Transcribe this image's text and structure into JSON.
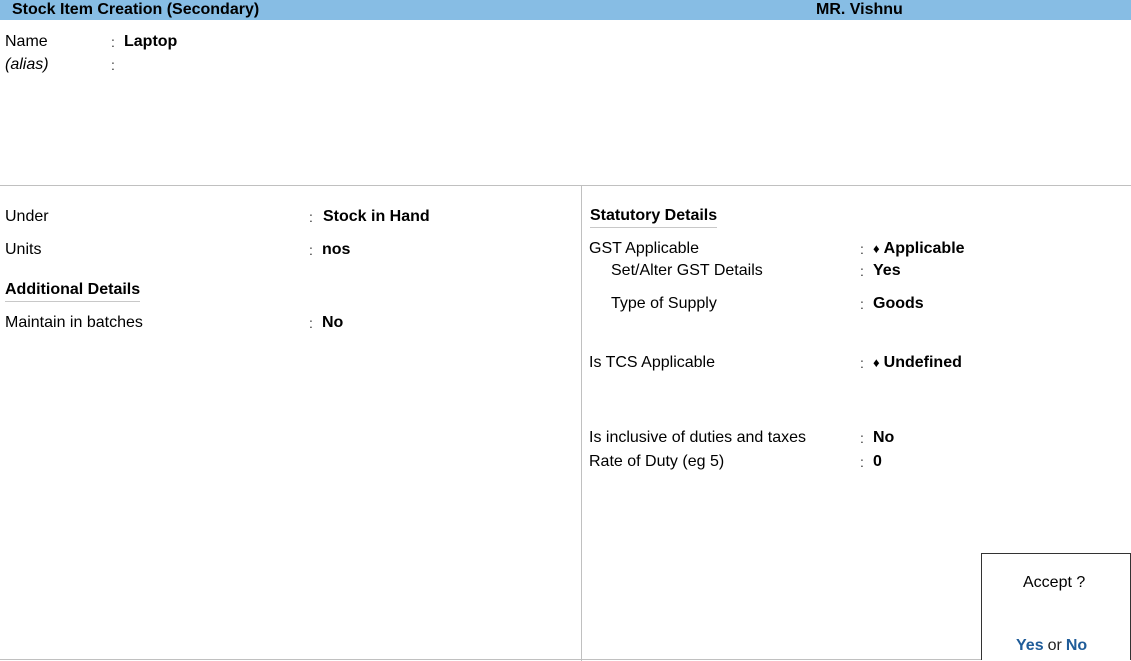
{
  "header": {
    "title": "Stock Item Creation (Secondary)",
    "company": "MR. Vishnu"
  },
  "top": {
    "name_label": "Name",
    "name_value": "Laptop",
    "alias_label": "(alias)",
    "alias_value": "",
    "colon": ":"
  },
  "left": {
    "under_label": "Under",
    "under_value": "Stock in Hand",
    "units_label": "Units",
    "units_value": "nos",
    "additional_heading": "Additional Details",
    "batches_label": "Maintain in batches",
    "batches_value": "No"
  },
  "right": {
    "statutory_heading": "Statutory Details",
    "gst_label": "GST Applicable",
    "gst_value": "Applicable",
    "set_alter_label": "Set/Alter GST Details",
    "set_alter_value": "Yes",
    "supply_label": "Type of Supply",
    "supply_value": "Goods",
    "tcs_label": "Is TCS Applicable",
    "tcs_value": "Undefined",
    "inclusive_label": "Is inclusive of duties and taxes",
    "inclusive_value": "No",
    "rate_label": "Rate of Duty (eg 5)",
    "rate_value": "0",
    "diamond_icon": "♦"
  },
  "accept": {
    "question": "Accept ?",
    "yes": "Yes",
    "or": "or",
    "no": "No"
  }
}
